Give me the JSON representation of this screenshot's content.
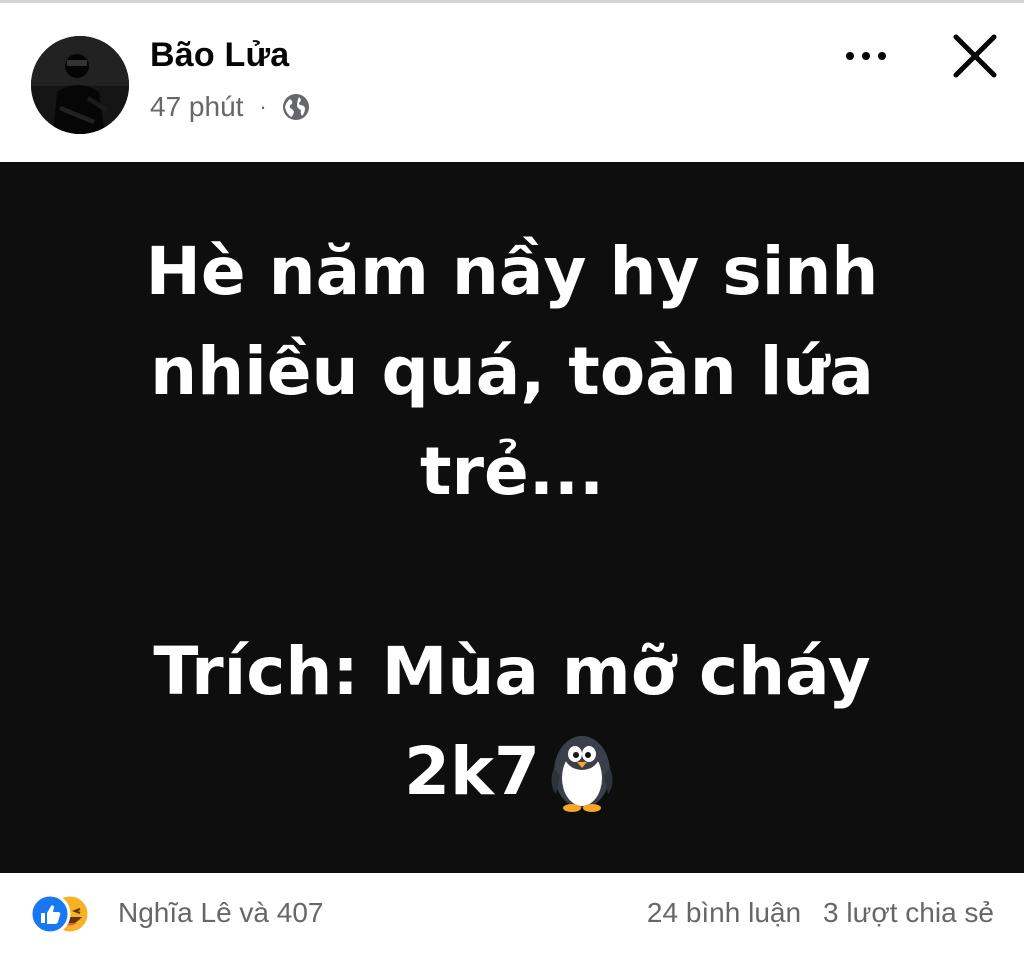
{
  "post": {
    "author": "Bão Lửa",
    "time": "47 phút",
    "separator": "·",
    "privacy_icon": "globe-icon",
    "content_lines": [
      "Hè năm nầy hy sinh",
      "nhiều quá, toàn lứa",
      "trẻ...",
      "Trích: Mùa mỡ cháy",
      "2k7"
    ],
    "content_emoji": "penguin",
    "background_color": "#0e0e0e",
    "text_color": "#ffffff"
  },
  "footer": {
    "reaction_icons": [
      "like-icon",
      "haha-icon"
    ],
    "reactors": "Nghĩa Lê và 407",
    "comments": "24 bình luận",
    "shares": "3 lượt chia sẻ"
  },
  "colors": {
    "like": "#1877f2",
    "haha": "#f7b125",
    "secondary_text": "#65676b"
  }
}
